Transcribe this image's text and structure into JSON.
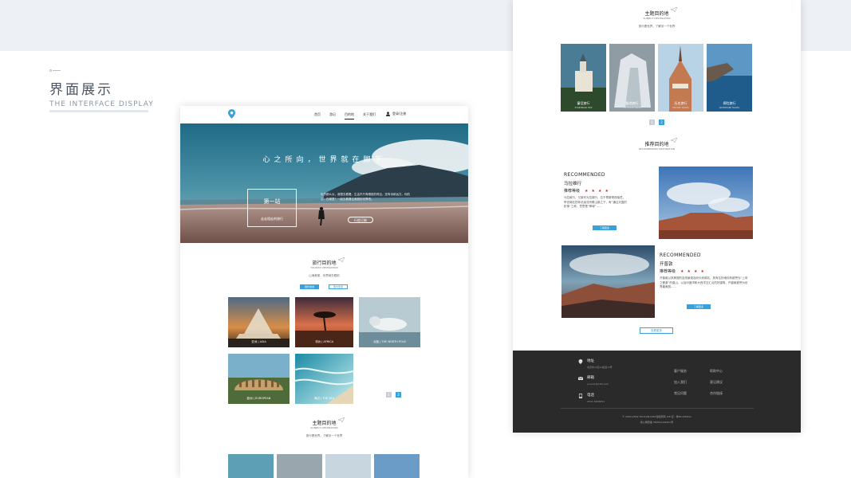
{
  "showcase": {
    "title": "界面展示",
    "subtitle": "THE INTERFACE DISPLAY"
  },
  "nav": {
    "items": [
      "首页",
      "游记",
      "目的地",
      "关于我们"
    ],
    "active_index": 2,
    "login": "登录/注册"
  },
  "hero": {
    "title": "心之所向，世界就在脚下",
    "box_title": "第一站",
    "box_subtitle": "走走相走的旅行",
    "text": "世界那么大，我想去看看。生活不只有眼前的苟且，还有诗和远方。你的心，在哪里？一起去看看这美丽的世界吧。",
    "button": "行程订制"
  },
  "tourist": {
    "title": "旅行目的地",
    "subtitle": "TOURIST DESTINATION",
    "desc": "山海美丽，世界就在眼前",
    "btn_primary": "国外旅游",
    "btn_secondary": "国内旅游",
    "cards": [
      {
        "cn": "亚洲",
        "en": "ASIA"
      },
      {
        "cn": "非洲",
        "en": "AFRICA"
      },
      {
        "cn": "北极",
        "en": "THE NORTH POLE"
      },
      {
        "cn": "欧洲",
        "en": "EUROPEAN"
      },
      {
        "cn": "海边",
        "en": "THE SEA"
      }
    ],
    "pages": [
      "1",
      "2"
    ]
  },
  "subject": {
    "title": "主题目的地",
    "subtitle": "SUBJECT DESTINATION",
    "desc": "旅行看世界，了解另一个世界",
    "cards": [
      {
        "cn": "童话旅行",
        "en": "STORYBOOK TRIP"
      },
      {
        "cn": "极地旅行",
        "en": "THE POLAR TRAVEL"
      },
      {
        "cn": "历史旅行",
        "en": "HISTORY TRAVEL"
      },
      {
        "cn": "探险旅行",
        "en": "ADVENTURE TRAVEL"
      }
    ],
    "pages": [
      "1",
      "2"
    ]
  },
  "recommended": {
    "title": "推荐目的地",
    "subtitle": "RECOMMENDED DESTINATION",
    "items": [
      {
        "tag": "RECOMMENDED",
        "name": "马拉维行",
        "level_label": "推荐等级",
        "stars": "★★★★",
        "desc": "马拉维行，又被作为拉姆行，位于蔡斯哥西南境，举世闻名的伴浓溪流宗教山脉之下，有“通往天国的阶梯”之称，意思是“神域”……",
        "button": "了解更多"
      },
      {
        "tag": "RECOMMENDED",
        "name": "开普敦",
        "level_label": "推荐等级",
        "stars": "★★★★",
        "desc": "开普敦以其美丽的自然景观及码头而闻名，其有名的地标有被誉为“上帝之餐桌”的桌山，以及印度洋和大西洋交汇点的好望角。开普敦被誉为世界最美丽……",
        "button": "了解更多"
      }
    ],
    "more": "查看更多"
  },
  "footer": {
    "address_label": "地址",
    "address_value": "北京市xx区xx街道xx号",
    "email_label": "邮箱",
    "email_value": "youcan@163.com",
    "phone_label": "电话",
    "phone_value": "0531-5465654",
    "links_col1": [
      "客户服务",
      "加入我们",
      "常见问题"
    ],
    "links_col2": [
      "帮助中心",
      "意见建议",
      "合作链接"
    ],
    "copyright": "© 2003-2019 YOUCAN.COM 版权所有 ICP 证：鲁B2-2004xx",
    "icp": "鲁公网安备 3505xxx024xx号"
  },
  "colors": {
    "accent": "#3aa0d8",
    "star": "#c0392b",
    "footer_bg": "#2a2a2a",
    "band": "#edf0f4"
  }
}
